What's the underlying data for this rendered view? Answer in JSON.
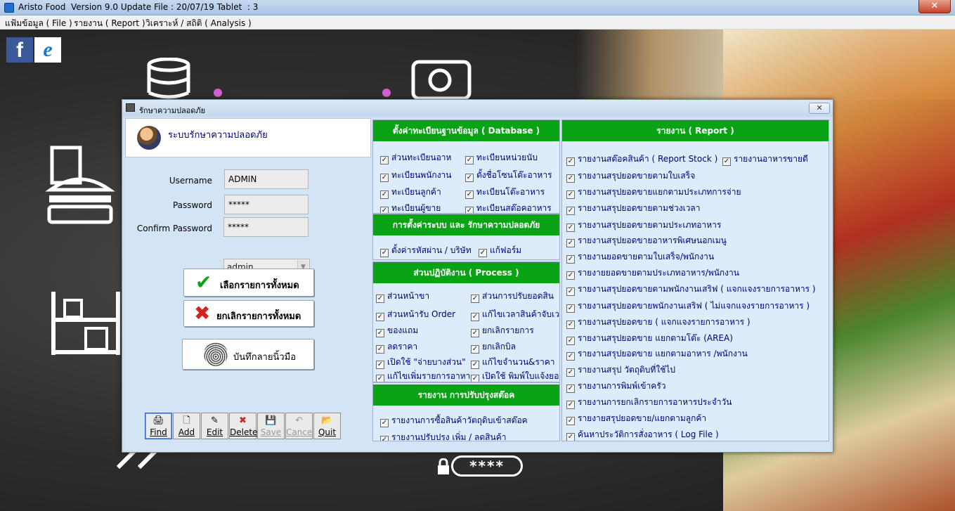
{
  "window": {
    "title": "Aristo Food  Version 9.0 Update File : 20/07/19 Tablet  : 3",
    "close_glyph": "✕"
  },
  "menu": [
    "แฟ้มข้อมูล ( File )",
    "รายงาน ( Report )",
    "วิเคราะห์ / สถิติ ( Analysis )"
  ],
  "desktop": {
    "pin_text": "****",
    "fb_glyph": "f",
    "ie_glyph": "e"
  },
  "dialog": {
    "title": "รักษาความปลอดภัย",
    "close_glyph": "✕",
    "header_label": "ระบบรักษาความปลอดภัย",
    "fields": {
      "username_label": "Username",
      "username_value": "ADMIN",
      "password_label": "Password",
      "password_value": "*****",
      "confirm_label": "Confirm Password",
      "confirm_value": "*****",
      "role_value": "admin",
      "role_arrow": "▼"
    },
    "buttons": {
      "select_all": "เลือกรายการทั้งหมด",
      "cancel_all": "ยกเลิกรายการทั้งหมด",
      "fingerprint": "บันทึกลายนิ้วมือ",
      "check_glyph": "✔",
      "cross_glyph": "✖"
    },
    "toolbar": [
      {
        "label": "Find",
        "icon": "🖨",
        "enabled": true
      },
      {
        "label": "Add",
        "icon": "🗋",
        "enabled": true
      },
      {
        "label": "Edit",
        "icon": "✎",
        "enabled": true
      },
      {
        "label": "Delete",
        "icon": "✖",
        "enabled": true
      },
      {
        "label": "Save",
        "icon": "💾",
        "enabled": false
      },
      {
        "label": "Cance",
        "icon": "↶",
        "enabled": false
      },
      {
        "label": "Quit",
        "icon": "📂",
        "enabled": true
      }
    ],
    "check_glyph": "✓",
    "database_panel": {
      "title": "ตั้งค่าทะเบียนฐานข้อมูล ( Database )",
      "left": [
        "ส่วนทะเบียนอาห",
        "ทะเบียนพนักงาน",
        "ทะเบียนลูกค้า",
        "ทะเบียนผู้ขาย"
      ],
      "right": [
        "ทะเบียนหน่วยนับ",
        "ตั้งชื่อโซนโต๊ะอาหาร",
        "ทะเบียนโต๊ะอาหาร",
        "ทะเบียนสต๊อคอาหาร"
      ]
    },
    "system_panel": {
      "title": "การตั้งค่าระบบ และ รักษาความปลอดภัย",
      "items": [
        "ตั้งค่ารหัสผ่าน / บริษัท",
        "แก้ฟอร์ม"
      ]
    },
    "process_panel": {
      "title": "ส่วนปฏิบัติงาน ( Process )",
      "left": [
        "ส่วนหน้าขา",
        "ส่วนหน้ารับ Order",
        "ของแถม",
        "ลดราคา",
        "เปิดใช้ \"จ่ายบางส่วน\"",
        "แก้ไขเพิ่มรายการอาหา"
      ],
      "right": [
        "ส่วนการปรับยอดสิน",
        "แก้ไขเวลาสินค้าจับเวลา",
        "ยกเลิกรายการ",
        "ยกเลิกบิล",
        "แก้ไขจำนวน&ราคา",
        "เปิดใช้ พิมพ์ใบแจ้งยอด"
      ]
    },
    "stock_panel": {
      "title": "รายงาน การปรับปรุงสต๊อค",
      "items": [
        "รายงานการซื้อสินค้าวัตถุดิบเข้าสต๊อค",
        "รายงานปรับปรุง เพิ่ม / ลดสินค้า"
      ]
    },
    "report_panel": {
      "title": "รายงาน ( Report )",
      "first_left": "รายงานสต๊อคสินค้า ( Report Stock )",
      "first_right": "รายงานอาหารขายดี",
      "items": [
        "รายงานสรุปยอดขายตามใบเสร็จ",
        "รายงานสรุปยอดขายแยกตามประเภทการจ่าย",
        "รายงานสรุปยอดขายตามช่วงเวลา",
        "รายงานสรุปยอดขายตามประเภทอาหาร",
        "รายงานสรุปยอดขายอาหารพิเศษนอกเมนู",
        "รายงานยอดขายตามใบเสร็จ/พนักงาน",
        "รายงายยอดขายตามประเภทอาหาร/พนักงาน",
        "รายงานสรุปยอดขายตามพนักงานเสริฟ ( แจกแจงรายการอาหาร )",
        "รายงานสรุปยอดขายพนักงานเสริฟ ( ไม่แจกแจงรายการอาหาร )",
        "รายงานสรุปยอดขาย ( แจกแจงรายการอาหาร )",
        "รายงานสรุปยอดขาย แยกตามโต๊ะ    (AREA)",
        "รายงานสรุปยอดขาย แยกตามอาหาร /พนักงาน",
        "รายงานสรุป วัตถุดิบที่ใช้ไป",
        "รายงานการพิมพ์เข้าครัว",
        "รายงานการยกเลิกรายการอาหารประจำวัน",
        "รายงายสรุปยอดขาย/แยกตามลูกค้า",
        "ค้นหาประวัติการสั่งอาหาร ( Log File )"
      ]
    }
  }
}
